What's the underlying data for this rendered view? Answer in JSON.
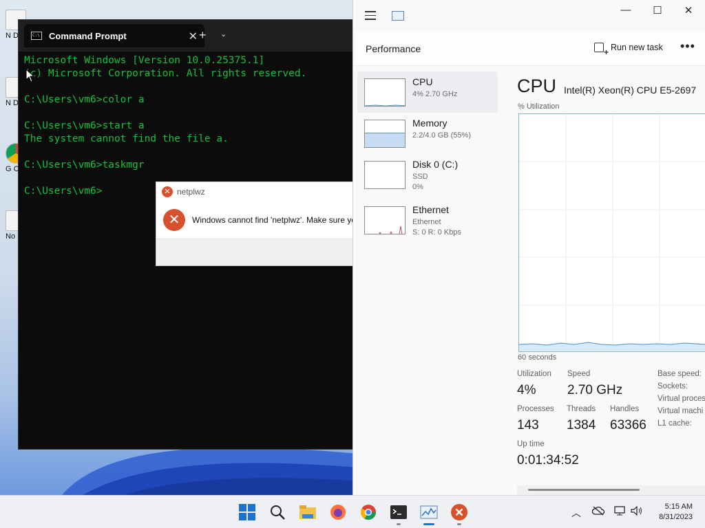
{
  "desktop": {
    "icons": [
      {
        "label": "N Do"
      },
      {
        "label": "N Do"
      },
      {
        "label": "G C"
      },
      {
        "label": "No"
      }
    ]
  },
  "cmd": {
    "tab_title": "Command Prompt",
    "lines": [
      "Microsoft Windows [Version 10.0.25375.1]",
      "(c) Microsoft Corporation. All rights reserved.",
      "",
      "C:\\Users\\vm6>color a",
      "",
      "C:\\Users\\vm6>start a",
      "The system cannot find the file a.",
      "",
      "C:\\Users\\vm6>taskmgr",
      "",
      "C:\\Users\\vm6>"
    ],
    "text_color": "#13c23b"
  },
  "dialog": {
    "title": "netplwz",
    "message": "Windows cannot find 'netplwz'. Make sure you typed the name correctly, and then try again."
  },
  "taskmgr": {
    "window_buttons": {
      "minimize": "—",
      "maximize": "☐",
      "close": "✕"
    },
    "page_title": "Performance",
    "run_new_task": "Run new task",
    "more": "•••",
    "side_items": [
      {
        "name": "CPU",
        "line1": "4%  2.70 GHz",
        "line2": ""
      },
      {
        "name": "Memory",
        "line1": "2.2/4.0 GB (55%)",
        "line2": ""
      },
      {
        "name": "Disk 0 (C:)",
        "line1": "SSD",
        "line2": "0%"
      },
      {
        "name": "Ethernet",
        "line1": "Ethernet",
        "line2": "S: 0  R: 0 Kbps"
      }
    ],
    "main": {
      "heading": "CPU",
      "model": "Intel(R) Xeon(R) CPU E5-2697",
      "util_label": "% Utilization",
      "duration_label": "60 seconds",
      "utilization_label": "Utilization",
      "utilization": "4%",
      "speed_label": "Speed",
      "speed": "2.70 GHz",
      "processes_label": "Processes",
      "processes": "143",
      "threads_label": "Threads",
      "threads": "1384",
      "handles_label": "Handles",
      "handles": "63366",
      "uptime_label": "Up time",
      "uptime": "0:01:34:52",
      "right_labels": [
        "Base speed:",
        "Sockets:",
        "Virtual proces",
        "Virtual machi",
        "L1 cache:"
      ]
    }
  },
  "taskbar": {
    "icons": [
      "windows-start-icon",
      "search-icon",
      "file-explorer-icon",
      "firefox-icon",
      "chrome-icon",
      "terminal-icon",
      "task-manager-icon",
      "error-icon"
    ],
    "time": "5:15 AM",
    "date": "8/31/2023"
  },
  "colors": {
    "accent": "#1a73d1",
    "error": "#d9512c",
    "graph_line": "#87b6d8"
  }
}
